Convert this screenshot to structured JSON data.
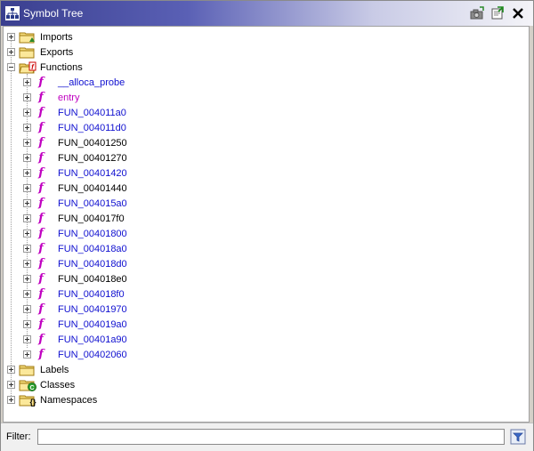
{
  "window": {
    "title": "Symbol Tree",
    "title_icon": "symbol-tree-icon",
    "buttons": [
      {
        "name": "snapshot-button",
        "icon": "camera-icon"
      },
      {
        "name": "navigate-button",
        "icon": "navigate-icon"
      },
      {
        "name": "close-button",
        "icon": "close-icon"
      }
    ]
  },
  "tree": {
    "top_level": [
      {
        "label": "Imports",
        "icon": "folder-imports-icon",
        "expanded": false
      },
      {
        "label": "Exports",
        "icon": "folder-exports-icon",
        "expanded": false
      },
      {
        "label": "Functions",
        "icon": "folder-functions-icon",
        "expanded": true
      },
      {
        "label": "Labels",
        "icon": "folder-labels-icon",
        "expanded": false
      },
      {
        "label": "Classes",
        "icon": "folder-classes-icon",
        "expanded": false
      },
      {
        "label": "Namespaces",
        "icon": "folder-namespaces-icon",
        "expanded": false
      }
    ],
    "functions": [
      {
        "label": "__alloca_probe",
        "color": "blue"
      },
      {
        "label": "entry",
        "color": "magenta"
      },
      {
        "label": "FUN_004011a0",
        "color": "blue"
      },
      {
        "label": "FUN_004011d0",
        "color": "blue"
      },
      {
        "label": "FUN_00401250",
        "color": "black"
      },
      {
        "label": "FUN_00401270",
        "color": "black"
      },
      {
        "label": "FUN_00401420",
        "color": "blue"
      },
      {
        "label": "FUN_00401440",
        "color": "black"
      },
      {
        "label": "FUN_004015a0",
        "color": "blue"
      },
      {
        "label": "FUN_004017f0",
        "color": "black"
      },
      {
        "label": "FUN_00401800",
        "color": "blue"
      },
      {
        "label": "FUN_004018a0",
        "color": "blue"
      },
      {
        "label": "FUN_004018d0",
        "color": "blue"
      },
      {
        "label": "FUN_004018e0",
        "color": "black"
      },
      {
        "label": "FUN_004018f0",
        "color": "blue"
      },
      {
        "label": "FUN_00401970",
        "color": "blue"
      },
      {
        "label": "FUN_004019a0",
        "color": "blue"
      },
      {
        "label": "FUN_00401a90",
        "color": "blue"
      },
      {
        "label": "FUN_00402060",
        "color": "blue"
      }
    ],
    "function_icon_glyph": "f"
  },
  "filter": {
    "label": "Filter:",
    "value": "",
    "button_icon": "filter-options-icon"
  },
  "colors": {
    "title_gradient_start": "#3a3f8f",
    "label_blue": "#1010d0",
    "label_magenta": "#c000c0",
    "function_icon": "#c000c0"
  }
}
